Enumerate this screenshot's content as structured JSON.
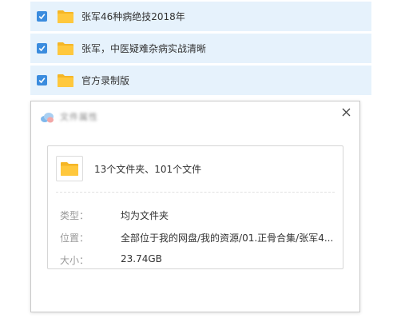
{
  "file_list": [
    {
      "name": "张军46种病绝技2018年",
      "checked": true,
      "icon": "folder-icon"
    },
    {
      "name": "张军，中医疑难杂病实战清晰",
      "checked": true,
      "icon": "folder-icon"
    },
    {
      "name": "官方录制版",
      "checked": true,
      "icon": "folder-icon"
    }
  ],
  "dialog": {
    "title": "文件属性",
    "app_icon": "cloud-app-icon",
    "close_icon": "close-icon",
    "summary": "13个文件夹、101个文件",
    "properties": [
      {
        "label": "类型：",
        "value": "均为文件夹"
      },
      {
        "label": "位置：",
        "value": "全部位于我的网盘/我的资源/01.正骨合集/张军4..."
      },
      {
        "label": "大小：",
        "value": "23.74GB"
      }
    ]
  },
  "colors": {
    "row_selected_bg": "#e6f2fc",
    "checkbox": "#3b8cde",
    "folder": "#ffc83d",
    "folder_tab": "#f5b626"
  }
}
